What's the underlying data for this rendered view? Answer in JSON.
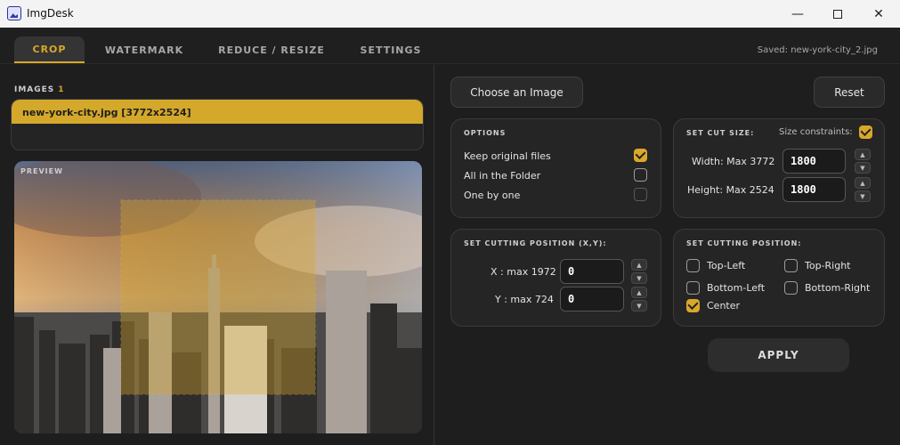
{
  "window": {
    "title": "ImgDesk"
  },
  "tabs": [
    {
      "label": "CROP",
      "active": true
    },
    {
      "label": "WATERMARK"
    },
    {
      "label": "REDUCE / RESIZE"
    },
    {
      "label": "SETTINGS"
    }
  ],
  "status": {
    "saved": "Saved: new-york-city_2.jpg"
  },
  "images": {
    "label": "IMAGES",
    "count": "1",
    "items": [
      "new-york-city.jpg [3772x2524]"
    ]
  },
  "preview": {
    "label": "PREVIEW"
  },
  "buttons": {
    "choose": "Choose an Image",
    "reset": "Reset",
    "apply": "APPLY"
  },
  "options": {
    "title": "OPTIONS",
    "items": [
      {
        "label": "Keep original files",
        "checked": true
      },
      {
        "label": "All in the Folder",
        "checked": false
      },
      {
        "label": "One by one",
        "checked": false
      }
    ]
  },
  "cut_size": {
    "title": "SET CUT SIZE:",
    "constraints_label": "Size constraints:",
    "constraints_checked": true,
    "width_label": "Width: Max 3772",
    "width_value": "1800",
    "height_label": "Height: Max 2524",
    "height_value": "1800"
  },
  "cut_position_xy": {
    "title": "SET CUTTING POSITION (X,Y):",
    "x_label": "X : max 1972",
    "x_value": "0",
    "y_label": "Y : max 724",
    "y_value": "0"
  },
  "cut_position": {
    "title": "SET CUTTING POSITION:",
    "top_left": "Top-Left",
    "top_right": "Top-Right",
    "bottom_left": "Bottom-Left",
    "bottom_right": "Bottom-Right",
    "center": "Center",
    "selected": "Center"
  },
  "spinner": {
    "up": "▲",
    "down": "▼"
  },
  "colors": {
    "accent": "#d9a72a",
    "background": "#1f1f1f",
    "card": "#252525"
  }
}
